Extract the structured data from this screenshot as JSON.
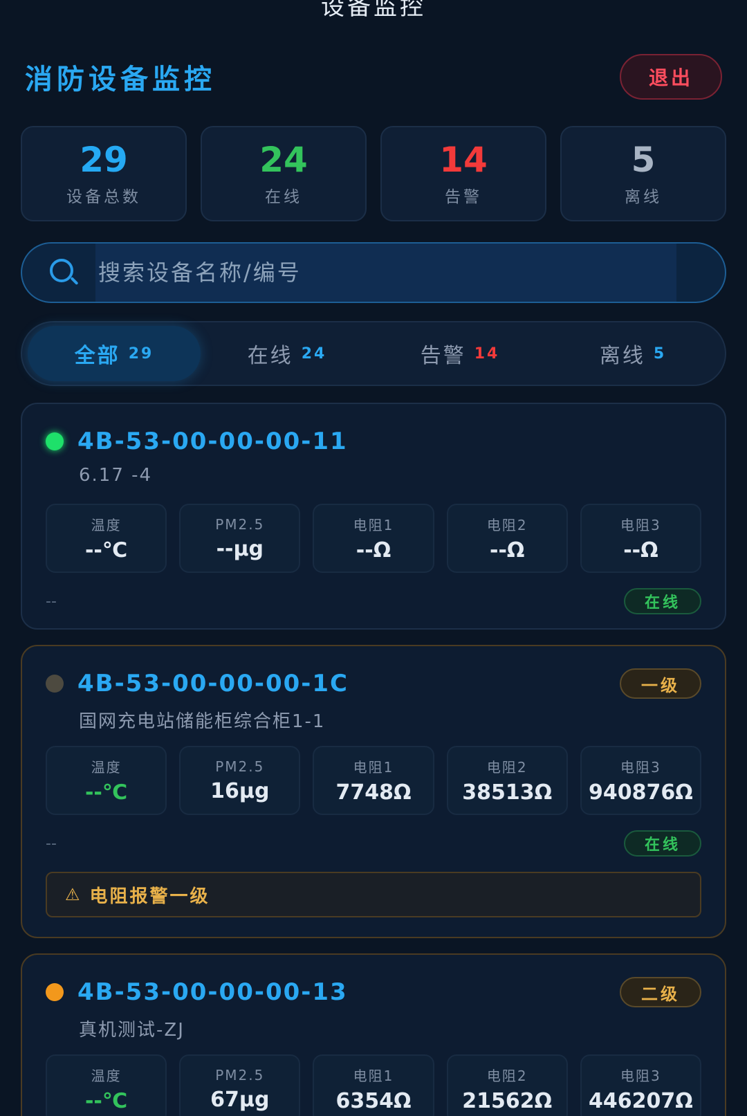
{
  "nav": {
    "title": "设备监控"
  },
  "header": {
    "title": "消防设备监控",
    "logout_label": "退出"
  },
  "stats": [
    {
      "value": "29",
      "label": "设备总数",
      "color": "#25a9f3"
    },
    {
      "value": "24",
      "label": "在线",
      "color": "#33c35c"
    },
    {
      "value": "14",
      "label": "告警",
      "color": "#f23a3a"
    },
    {
      "value": "5",
      "label": "离线",
      "color": "#a8b4c4"
    }
  ],
  "search": {
    "placeholder": "搜索设备名称/编号",
    "icon": "search-icon"
  },
  "tabs": [
    {
      "label": "全部",
      "count": "29",
      "active": true
    },
    {
      "label": "在线",
      "count": "24",
      "count_color": "#2aa8f2"
    },
    {
      "label": "告警",
      "count": "14",
      "count_color": "#f23a3a"
    },
    {
      "label": "离线",
      "count": "5",
      "count_color": "#2aa8f2"
    }
  ],
  "devices": [
    {
      "id": "4B-53-00-00-00-11",
      "name": "6.17 -4",
      "dot_color": "#1ee06a",
      "metrics": [
        {
          "label": "温度",
          "value": "--℃"
        },
        {
          "label": "PM2.5",
          "value": "--μg"
        },
        {
          "label": "电阻1",
          "value": "--Ω"
        },
        {
          "label": "电阻2",
          "value": "--Ω"
        },
        {
          "label": "电阻3",
          "value": "--Ω"
        }
      ],
      "time": "--",
      "status": "在线"
    },
    {
      "id": "4B-53-00-00-00-1C",
      "name": "国网充电站储能柜综合柜1-1",
      "dot_color": "#4d4a40",
      "level": "一级",
      "metrics": [
        {
          "label": "温度",
          "value": "--℃"
        },
        {
          "label": "PM2.5",
          "value": "16μg"
        },
        {
          "label": "电阻1",
          "value": "7748Ω"
        },
        {
          "label": "电阻2",
          "value": "38513Ω"
        },
        {
          "label": "电阻3",
          "value": "940876Ω"
        }
      ],
      "time": "--",
      "status": "在线",
      "alert": "电阻报警一级"
    },
    {
      "id": "4B-53-00-00-00-13",
      "name": "真机测试-ZJ",
      "dot_color": "#f2981c",
      "level": "二级",
      "metrics": [
        {
          "label": "温度",
          "value": "--℃"
        },
        {
          "label": "PM2.5",
          "value": "67μg"
        },
        {
          "label": "电阻1",
          "value": "6354Ω"
        },
        {
          "label": "电阻2",
          "value": "21562Ω"
        },
        {
          "label": "电阻3",
          "value": "446207Ω"
        }
      ]
    }
  ]
}
